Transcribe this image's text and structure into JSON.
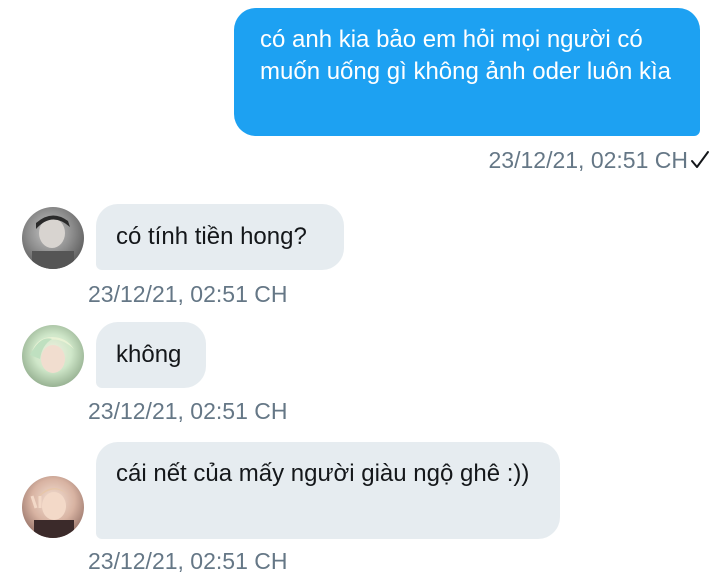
{
  "messages": [
    {
      "direction": "outgoing",
      "text": "có anh kia bảo em hỏi mọi người có muốn uống gì không ảnh oder luôn kìa",
      "timestamp": "23/12/21, 02:51 CH",
      "status_icon": "check-icon"
    },
    {
      "direction": "incoming",
      "avatar": "avatar-user-1",
      "text": "có tính tiền hong?",
      "timestamp": "23/12/21, 02:51 CH"
    },
    {
      "direction": "incoming",
      "avatar": "avatar-user-2",
      "text": "không",
      "timestamp": "23/12/21, 02:51 CH"
    },
    {
      "direction": "incoming",
      "avatar": "avatar-user-3",
      "text": "cái nết của mấy người giàu ngộ ghê :))",
      "timestamp": "23/12/21, 02:51 CH"
    }
  ],
  "colors": {
    "outgoing_bubble": "#1da1f2",
    "incoming_bubble": "#e6ecf0",
    "timestamp": "#657786"
  }
}
